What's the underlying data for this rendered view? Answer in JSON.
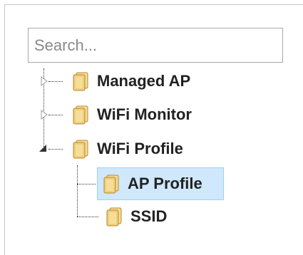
{
  "search": {
    "placeholder": "Search..."
  },
  "tree": {
    "nodes": [
      {
        "label": "Managed AP",
        "expanded": false,
        "icon": "folder-icon"
      },
      {
        "label": "WiFi Monitor",
        "expanded": false,
        "icon": "folder-icon"
      },
      {
        "label": "WiFi Profile",
        "expanded": true,
        "icon": "folder-icon",
        "children": [
          {
            "label": "AP Profile",
            "selected": true,
            "icon": "folder-icon"
          },
          {
            "label": "SSID",
            "selected": false,
            "icon": "folder-icon"
          }
        ]
      }
    ]
  },
  "colors": {
    "selection_bg": "#cfe8fc",
    "selection_border": "#99d1ff",
    "folder_fill": "#f0cf7a",
    "folder_edge": "#b8862f"
  }
}
